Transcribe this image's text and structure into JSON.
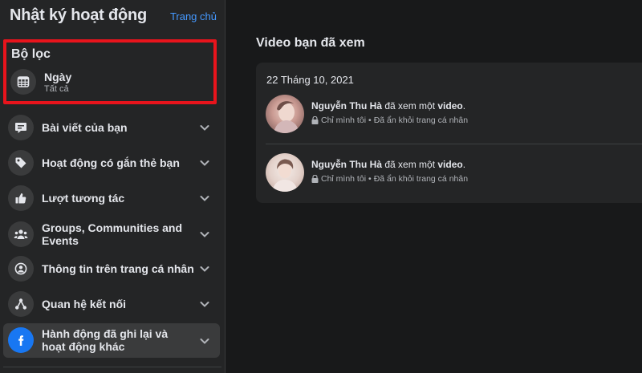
{
  "sidebar": {
    "title": "Nhật ký hoạt động",
    "home_link": "Trang chủ",
    "filter": {
      "label": "Bộ lọc",
      "item_label": "Ngày",
      "item_value": "Tất cả"
    },
    "items": [
      {
        "label": "Bài viết của bạn",
        "icon": "comment-icon"
      },
      {
        "label": "Hoạt động có gắn thẻ bạn",
        "icon": "tag-icon"
      },
      {
        "label": "Lượt tương tác",
        "icon": "thumbs-up-icon"
      },
      {
        "label": "Groups, Communities and Events",
        "icon": "people-icon"
      },
      {
        "label": "Thông tin trên trang cá nhân",
        "icon": "profile-icon"
      },
      {
        "label": "Quan hệ kết nối",
        "icon": "connections-icon"
      },
      {
        "label": "Hành động đã ghi lại và hoạt động khác",
        "icon": "facebook-icon"
      }
    ]
  },
  "main": {
    "title": "Video bạn đã xem",
    "date": "22 Tháng 10, 2021",
    "entries": [
      {
        "name": "Nguyễn Thu Hà",
        "action": " đã xem một ",
        "object": "video",
        "end": ".",
        "privacy": "Chỉ mình tôi",
        "sep": " • ",
        "status": "Đã ẩn khỏi trang cá nhân"
      },
      {
        "name": "Nguyễn Thu Hà",
        "action": " đã xem một ",
        "object": "video",
        "end": ".",
        "privacy": "Chỉ mình tôi",
        "sep": " • ",
        "status": "Đã ẩn khỏi trang cá nhân"
      }
    ]
  },
  "colors": {
    "background": "#18191a",
    "panel": "#242526",
    "accent_link": "#4599ff",
    "highlight_frame": "#e8141c",
    "facebook_blue": "#1877f2"
  }
}
